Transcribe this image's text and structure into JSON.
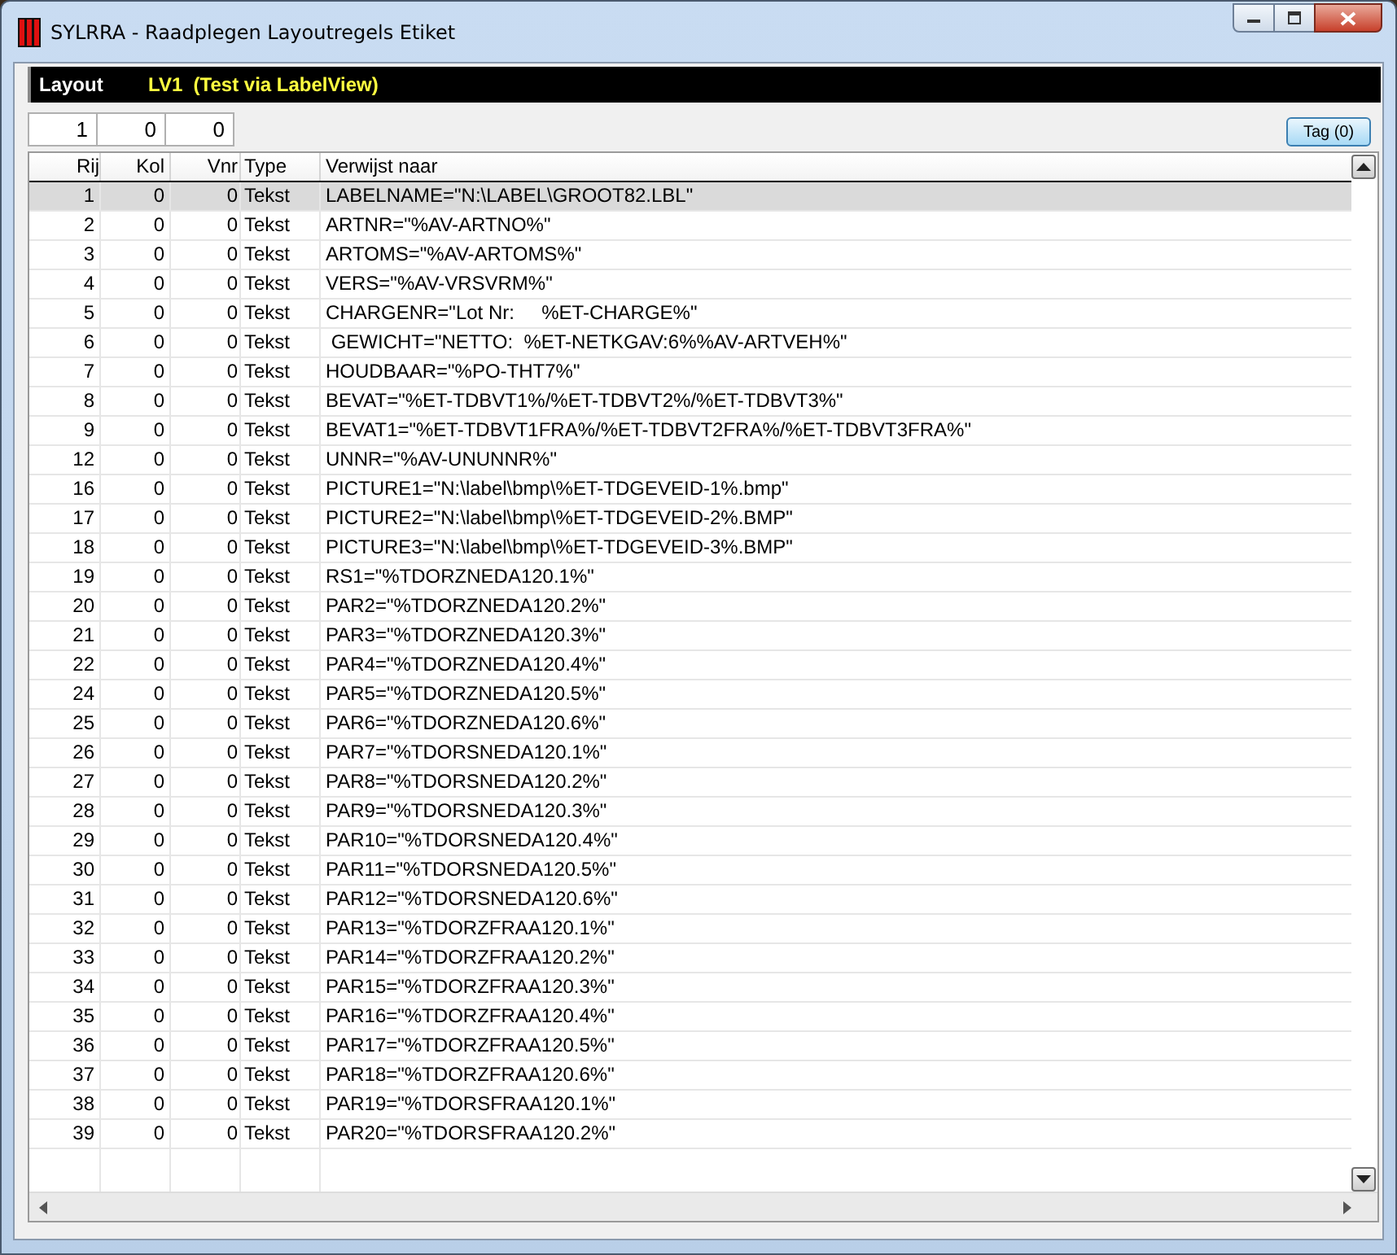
{
  "window": {
    "title": "SYLRRA - Raadplegen Layoutregels Etiket"
  },
  "layout_bar": {
    "label": "Layout",
    "value": "LV1  (Test via LabelView)"
  },
  "fields": [
    "1",
    "0",
    "0"
  ],
  "tag_button": "Tag (0)",
  "table": {
    "columns": [
      "Rij",
      "Kol",
      "Vnr",
      "Type",
      "Verwijst naar"
    ],
    "rows": [
      {
        "rij": "1",
        "kol": "0",
        "vnr": "0",
        "type": "Tekst",
        "ref": "LABELNAME=\"N:\\LABEL\\GROOT82.LBL\"",
        "selected": true
      },
      {
        "rij": "2",
        "kol": "0",
        "vnr": "0",
        "type": "Tekst",
        "ref": "ARTNR=\"%AV-ARTNO%\"",
        "selected": false
      },
      {
        "rij": "3",
        "kol": "0",
        "vnr": "0",
        "type": "Tekst",
        "ref": "ARTOMS=\"%AV-ARTOMS%\"",
        "selected": false
      },
      {
        "rij": "4",
        "kol": "0",
        "vnr": "0",
        "type": "Tekst",
        "ref": "VERS=\"%AV-VRSVRM%\"",
        "selected": false
      },
      {
        "rij": "5",
        "kol": "0",
        "vnr": "0",
        "type": "Tekst",
        "ref": "CHARGENR=\"Lot Nr:     %ET-CHARGE%\"",
        "selected": false
      },
      {
        "rij": "6",
        "kol": "0",
        "vnr": "0",
        "type": "Tekst",
        "ref": " GEWICHT=\"NETTO:  %ET-NETKGAV:6%%AV-ARTVEH%\"",
        "selected": false
      },
      {
        "rij": "7",
        "kol": "0",
        "vnr": "0",
        "type": "Tekst",
        "ref": "HOUDBAAR=\"%PO-THT7%\"",
        "selected": false
      },
      {
        "rij": "8",
        "kol": "0",
        "vnr": "0",
        "type": "Tekst",
        "ref": "BEVAT=\"%ET-TDBVT1%/%ET-TDBVT2%/%ET-TDBVT3%\"",
        "selected": false
      },
      {
        "rij": "9",
        "kol": "0",
        "vnr": "0",
        "type": "Tekst",
        "ref": "BEVAT1=\"%ET-TDBVT1FRA%/%ET-TDBVT2FRA%/%ET-TDBVT3FRA%\"",
        "selected": false
      },
      {
        "rij": "12",
        "kol": "0",
        "vnr": "0",
        "type": "Tekst",
        "ref": "UNNR=\"%AV-UNUNNR%\"",
        "selected": false
      },
      {
        "rij": "16",
        "kol": "0",
        "vnr": "0",
        "type": "Tekst",
        "ref": "PICTURE1=\"N:\\label\\bmp\\%ET-TDGEVEID-1%.bmp\"",
        "selected": false
      },
      {
        "rij": "17",
        "kol": "0",
        "vnr": "0",
        "type": "Tekst",
        "ref": "PICTURE2=\"N:\\label\\bmp\\%ET-TDGEVEID-2%.BMP\"",
        "selected": false
      },
      {
        "rij": "18",
        "kol": "0",
        "vnr": "0",
        "type": "Tekst",
        "ref": "PICTURE3=\"N:\\label\\bmp\\%ET-TDGEVEID-3%.BMP\"",
        "selected": false
      },
      {
        "rij": "19",
        "kol": "0",
        "vnr": "0",
        "type": "Tekst",
        "ref": "RS1=\"%TDORZNEDA120.1%\"",
        "selected": false
      },
      {
        "rij": "20",
        "kol": "0",
        "vnr": "0",
        "type": "Tekst",
        "ref": "PAR2=\"%TDORZNEDA120.2%\"",
        "selected": false
      },
      {
        "rij": "21",
        "kol": "0",
        "vnr": "0",
        "type": "Tekst",
        "ref": "PAR3=\"%TDORZNEDA120.3%\"",
        "selected": false
      },
      {
        "rij": "22",
        "kol": "0",
        "vnr": "0",
        "type": "Tekst",
        "ref": "PAR4=\"%TDORZNEDA120.4%\"",
        "selected": false
      },
      {
        "rij": "24",
        "kol": "0",
        "vnr": "0",
        "type": "Tekst",
        "ref": "PAR5=\"%TDORZNEDA120.5%\"",
        "selected": false
      },
      {
        "rij": "25",
        "kol": "0",
        "vnr": "0",
        "type": "Tekst",
        "ref": "PAR6=\"%TDORZNEDA120.6%\"",
        "selected": false
      },
      {
        "rij": "26",
        "kol": "0",
        "vnr": "0",
        "type": "Tekst",
        "ref": "PAR7=\"%TDORSNEDA120.1%\"",
        "selected": false
      },
      {
        "rij": "27",
        "kol": "0",
        "vnr": "0",
        "type": "Tekst",
        "ref": "PAR8=\"%TDORSNEDA120.2%\"",
        "selected": false
      },
      {
        "rij": "28",
        "kol": "0",
        "vnr": "0",
        "type": "Tekst",
        "ref": "PAR9=\"%TDORSNEDA120.3%\"",
        "selected": false
      },
      {
        "rij": "29",
        "kol": "0",
        "vnr": "0",
        "type": "Tekst",
        "ref": "PAR10=\"%TDORSNEDA120.4%\"",
        "selected": false
      },
      {
        "rij": "30",
        "kol": "0",
        "vnr": "0",
        "type": "Tekst",
        "ref": "PAR11=\"%TDORSNEDA120.5%\"",
        "selected": false
      },
      {
        "rij": "31",
        "kol": "0",
        "vnr": "0",
        "type": "Tekst",
        "ref": "PAR12=\"%TDORSNEDA120.6%\"",
        "selected": false
      },
      {
        "rij": "32",
        "kol": "0",
        "vnr": "0",
        "type": "Tekst",
        "ref": "PAR13=\"%TDORZFRAA120.1%\"",
        "selected": false
      },
      {
        "rij": "33",
        "kol": "0",
        "vnr": "0",
        "type": "Tekst",
        "ref": "PAR14=\"%TDORZFRAA120.2%\"",
        "selected": false
      },
      {
        "rij": "34",
        "kol": "0",
        "vnr": "0",
        "type": "Tekst",
        "ref": "PAR15=\"%TDORZFRAA120.3%\"",
        "selected": false
      },
      {
        "rij": "35",
        "kol": "0",
        "vnr": "0",
        "type": "Tekst",
        "ref": "PAR16=\"%TDORZFRAA120.4%\"",
        "selected": false
      },
      {
        "rij": "36",
        "kol": "0",
        "vnr": "0",
        "type": "Tekst",
        "ref": "PAR17=\"%TDORZFRAA120.5%\"",
        "selected": false
      },
      {
        "rij": "37",
        "kol": "0",
        "vnr": "0",
        "type": "Tekst",
        "ref": "PAR18=\"%TDORZFRAA120.6%\"",
        "selected": false
      },
      {
        "rij": "38",
        "kol": "0",
        "vnr": "0",
        "type": "Tekst",
        "ref": "PAR19=\"%TDORSFRAA120.1%\"",
        "selected": false
      },
      {
        "rij": "39",
        "kol": "0",
        "vnr": "0",
        "type": "Tekst",
        "ref": "PAR20=\"%TDORSFRAA120.2%\"",
        "selected": false
      }
    ]
  }
}
